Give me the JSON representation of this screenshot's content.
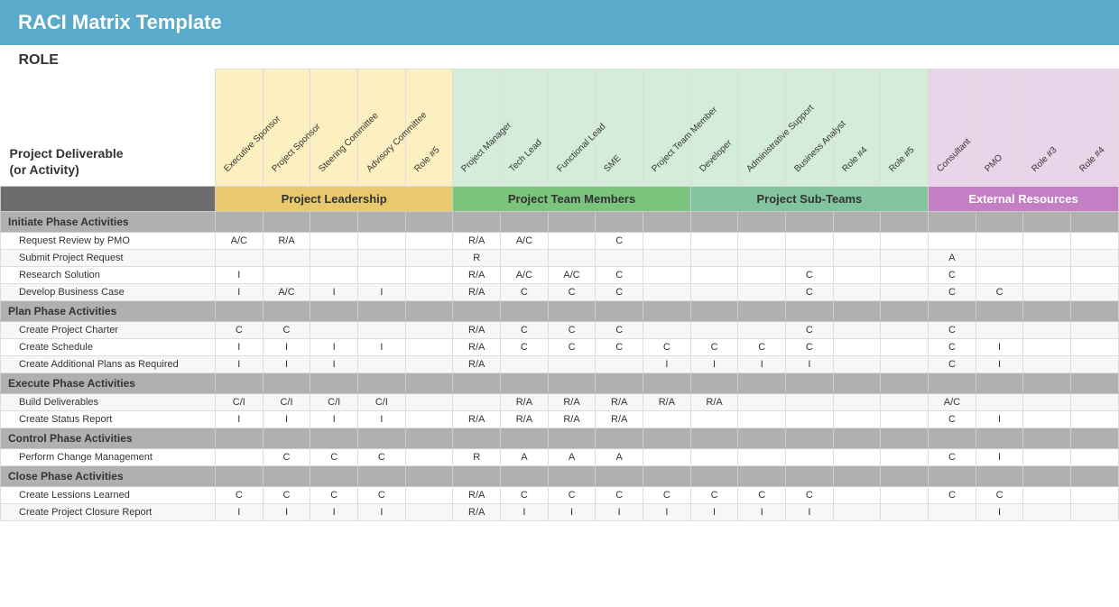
{
  "header": {
    "title": "RACI Matrix Template"
  },
  "role_label": "ROLE",
  "activity_header": "Project Deliverable\n(or Activity)",
  "groups": [
    {
      "label": "Project Leadership",
      "class": "group-leadership",
      "colspan": 5
    },
    {
      "label": "Project Team Members",
      "class": "group-team",
      "colspan": 4
    },
    {
      "label": "Project Sub-Teams",
      "class": "group-subteams",
      "colspan": 5
    },
    {
      "label": "External Resources",
      "class": "group-external",
      "colspan": 4
    }
  ],
  "roles": [
    {
      "label": "Executive Sponsor",
      "group": "leadership"
    },
    {
      "label": "Project Sponsor",
      "group": "leadership"
    },
    {
      "label": "Steering Committee",
      "group": "leadership"
    },
    {
      "label": "Advisory Committee",
      "group": "leadership"
    },
    {
      "label": "Role #5",
      "group": "leadership"
    },
    {
      "label": "Project Manager",
      "group": "team"
    },
    {
      "label": "Tech Lead",
      "group": "team"
    },
    {
      "label": "Functional Lead",
      "group": "team"
    },
    {
      "label": "SME",
      "group": "team"
    },
    {
      "label": "Project Team Member",
      "group": "team"
    },
    {
      "label": "Developer",
      "group": "subteams"
    },
    {
      "label": "Administrative Support",
      "group": "subteams"
    },
    {
      "label": "Business Analyst",
      "group": "subteams"
    },
    {
      "label": "Role #4",
      "group": "subteams"
    },
    {
      "label": "Role #5",
      "group": "subteams"
    },
    {
      "label": "Consultant",
      "group": "external"
    },
    {
      "label": "PMO",
      "group": "external"
    },
    {
      "label": "Role #3",
      "group": "external"
    },
    {
      "label": "Role #4",
      "group": "external"
    }
  ],
  "phases": [
    {
      "name": "Initiate Phase Activities",
      "rows": [
        {
          "activity": "Request Review by PMO",
          "values": [
            "A/C",
            "R/A",
            "",
            "",
            "",
            "R/A",
            "A/C",
            "",
            "C",
            "",
            "",
            "",
            "",
            "",
            "",
            "",
            "",
            "",
            ""
          ]
        },
        {
          "activity": "Submit Project Request",
          "values": [
            "",
            "",
            "",
            "",
            "",
            "R",
            "",
            "",
            "",
            "",
            "",
            "",
            "",
            "",
            "",
            "A",
            "",
            "",
            ""
          ]
        },
        {
          "activity": "Research Solution",
          "values": [
            "I",
            "",
            "",
            "",
            "",
            "R/A",
            "A/C",
            "A/C",
            "C",
            "",
            "",
            "",
            "C",
            "",
            "",
            "C",
            "",
            "",
            ""
          ]
        },
        {
          "activity": "Develop Business Case",
          "values": [
            "I",
            "A/C",
            "I",
            "I",
            "",
            "R/A",
            "C",
            "C",
            "C",
            "",
            "",
            "",
            "C",
            "",
            "",
            "C",
            "C",
            "",
            ""
          ]
        }
      ]
    },
    {
      "name": "Plan Phase Activities",
      "rows": [
        {
          "activity": "Create Project Charter",
          "values": [
            "C",
            "C",
            "",
            "",
            "",
            "R/A",
            "C",
            "C",
            "C",
            "",
            "",
            "",
            "C",
            "",
            "",
            "C",
            "",
            "",
            ""
          ]
        },
        {
          "activity": "Create Schedule",
          "values": [
            "I",
            "I",
            "I",
            "I",
            "",
            "R/A",
            "C",
            "C",
            "C",
            "C",
            "C",
            "C",
            "C",
            "",
            "",
            "C",
            "I",
            "",
            ""
          ]
        },
        {
          "activity": "Create Additional Plans as Required",
          "values": [
            "I",
            "I",
            "I",
            "",
            "",
            "R/A",
            "",
            "",
            "",
            "I",
            "I",
            "I",
            "I",
            "",
            "",
            "C",
            "I",
            "",
            ""
          ]
        }
      ]
    },
    {
      "name": "Execute Phase Activities",
      "rows": [
        {
          "activity": "Build Deliverables",
          "values": [
            "C/I",
            "C/I",
            "C/I",
            "C/I",
            "",
            "",
            "R/A",
            "R/A",
            "R/A",
            "R/A",
            "R/A",
            "",
            "",
            "",
            "",
            "A/C",
            "",
            "",
            ""
          ]
        },
        {
          "activity": "Create Status Report",
          "values": [
            "I",
            "I",
            "I",
            "I",
            "",
            "R/A",
            "R/A",
            "R/A",
            "R/A",
            "",
            "",
            "",
            "",
            "",
            "",
            "C",
            "I",
            "",
            ""
          ]
        }
      ]
    },
    {
      "name": "Control Phase Activities",
      "rows": [
        {
          "activity": "Perform Change Management",
          "values": [
            "",
            "C",
            "C",
            "C",
            "",
            "R",
            "A",
            "A",
            "A",
            "",
            "",
            "",
            "",
            "",
            "",
            "C",
            "I",
            "",
            ""
          ]
        }
      ]
    },
    {
      "name": "Close Phase Activities",
      "rows": [
        {
          "activity": "Create Lessions Learned",
          "values": [
            "C",
            "C",
            "C",
            "C",
            "",
            "R/A",
            "C",
            "C",
            "C",
            "C",
            "C",
            "C",
            "C",
            "",
            "",
            "C",
            "C",
            "",
            ""
          ]
        },
        {
          "activity": "Create Project Closure Report",
          "values": [
            "I",
            "I",
            "I",
            "I",
            "",
            "R/A",
            "I",
            "I",
            "I",
            "I",
            "I",
            "I",
            "I",
            "",
            "",
            "",
            "I",
            "",
            ""
          ]
        }
      ]
    }
  ]
}
